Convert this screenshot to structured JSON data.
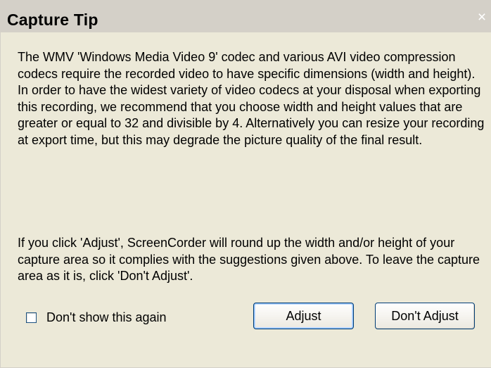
{
  "window": {
    "title": "Capture Tip",
    "close_glyph": "×"
  },
  "message": {
    "paragraph1": "The WMV 'Windows Media Video 9' codec and various AVI video compression codecs require the recorded video to have specific dimensions (width and height). In order to have the widest variety of video codecs at your disposal when exporting this recording, we recommend that you choose width and height values that are greater or equal to 32 and divisible by 4. Alternatively you can resize your recording at export time, but this may degrade the picture quality of the final result.",
    "paragraph2": "If you click 'Adjust', ScreenCorder will round up the width and/or height of your capture area so it complies with the suggestions given above. To leave the capture area as it is, click 'Don't Adjust'."
  },
  "options": {
    "dont_show_label": "Don't show this again",
    "dont_show_checked": false
  },
  "buttons": {
    "adjust": "Adjust",
    "dont_adjust": "Don't Adjust"
  },
  "colors": {
    "dialog_bg": "#ece9d8",
    "titlebar_bg": "#d4d0c8",
    "button_border": "#003c74"
  },
  "icons": {
    "close": "close-icon",
    "checkbox": "checkbox-icon"
  }
}
